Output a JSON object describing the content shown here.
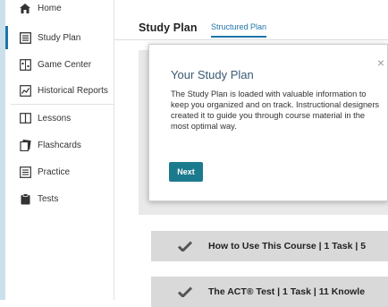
{
  "sidebar": {
    "items": [
      {
        "label": "Home",
        "icon": "home-icon"
      },
      {
        "label": "Study Plan",
        "icon": "study-plan-icon",
        "active": true
      },
      {
        "label": "Game Center",
        "icon": "game-center-icon"
      },
      {
        "label": "Historical Reports",
        "icon": "chart-icon"
      },
      {
        "label": "Lessons",
        "icon": "book-icon"
      },
      {
        "label": "Flashcards",
        "icon": "flashcards-icon"
      },
      {
        "label": "Practice",
        "icon": "practice-list-icon"
      },
      {
        "label": "Tests",
        "icon": "clipboard-icon"
      }
    ],
    "accent": "#1f75a8"
  },
  "main": {
    "title": "Study Plan",
    "tabs": [
      {
        "label": "Structured Plan",
        "active": true
      }
    ]
  },
  "modal": {
    "title": "Your Study Plan",
    "body": "The Study Plan is loaded with valuable information to keep you organized and on track. Instructional designers created it to guide you through course material in the most optimal way.",
    "close_icon": "close-icon",
    "next_label": "Next",
    "button_color": "#1c7a8e"
  },
  "lessons": [
    {
      "title": "How to Use This Course | 1 Task | 5",
      "completed": true
    },
    {
      "title": "The ACT® Test | 1 Task | 11 Knowle",
      "completed": true
    }
  ]
}
